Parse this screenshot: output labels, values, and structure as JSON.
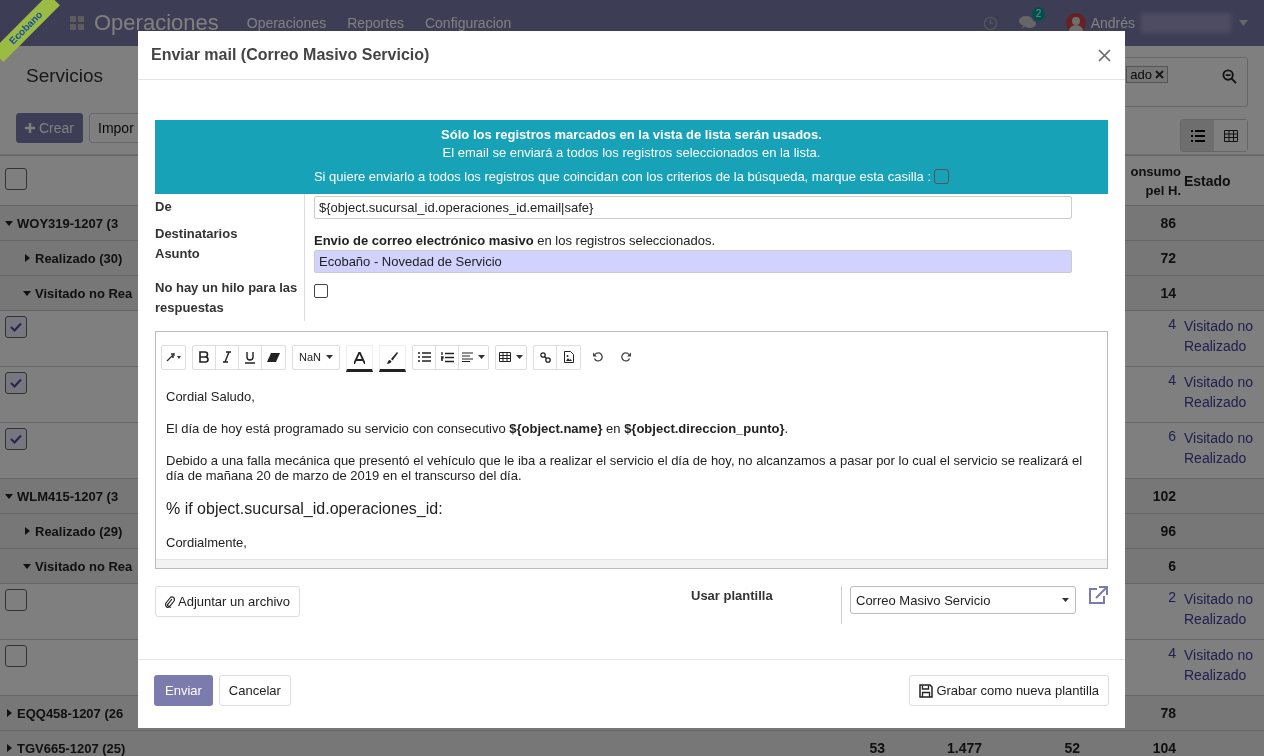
{
  "navbar": {
    "brand": "Operaciones",
    "menu": [
      "Operaciones",
      "Reportes",
      "Configuracion"
    ],
    "messages_count": "2",
    "user_name": "Andrés"
  },
  "ribbon": {
    "label": "Ecobano"
  },
  "breadcrumb": "Servicios",
  "create_button": "Crear",
  "import_button": "Impor",
  "search": {
    "facet": "ado"
  },
  "views": [
    {
      "kind": "list",
      "selected": true
    },
    {
      "kind": "grid",
      "selected": false
    }
  ],
  "table": {
    "select_all": false,
    "columns": [
      "onsumo\npel H.",
      "Estado"
    ],
    "rows": [
      {
        "kind": "group",
        "label": "WOY319-1207 (3",
        "expanded": true,
        "value": "86"
      },
      {
        "kind": "subgroup",
        "label": "Realizado (30)",
        "expanded": false,
        "value": "72"
      },
      {
        "kind": "subgroup",
        "label": "Visitado no Rea",
        "expanded": true,
        "value": "14"
      },
      {
        "kind": "record",
        "checked": true,
        "value": "4",
        "estado": "Visitado no\nRealizado"
      },
      {
        "kind": "record",
        "checked": true,
        "value": "4",
        "estado": "Visitado no\nRealizado"
      },
      {
        "kind": "record",
        "checked": true,
        "value": "6",
        "estado": "Visitado no\nRealizado"
      },
      {
        "kind": "group",
        "label": "WLM415-1207 (3",
        "expanded": true,
        "value": "102"
      },
      {
        "kind": "subgroup",
        "label": "Realizado (29)",
        "expanded": false,
        "value": "96"
      },
      {
        "kind": "subgroup",
        "label": "Visitado no Rea",
        "expanded": true,
        "value": "6"
      },
      {
        "kind": "record",
        "checked": false,
        "value": "2",
        "estado": "Visitado no\nRealizado"
      },
      {
        "kind": "record",
        "checked": false,
        "value": "4",
        "estado": "Visitado no\nRealizado"
      },
      {
        "kind": "group",
        "label": "EQQ458-1207 (26",
        "expanded": false,
        "value": "78"
      },
      {
        "kind": "group",
        "label": "TGV665-1207 (25)",
        "expanded": false,
        "extra": [
          "53",
          "1.477",
          "52"
        ],
        "value": "104"
      }
    ]
  },
  "dialog": {
    "title": "Enviar mail (Correo Masivo Servicio)",
    "alert": {
      "title": "Sólo los registros marcados en la vista de lista serán usados.",
      "text": "El email se enviará a todos los registros seleccionados en la lista.",
      "check_label": "Si quiere enviarlo a todos los registros que coincidan con los criterios de la búsqueda, marque esta casilla :",
      "checked": false
    },
    "from_label": "De",
    "from_value": "${object.sucursal_id.operaciones_id.email|safe}",
    "recipients_label": "Destinatarios",
    "recipients_text": "**Envio de correo electrónico masivo** en los registros seleccionados.",
    "subject_label": "Asunto",
    "subject_value": "Ecobaño - Novedad de Servicio",
    "no_thread_label": "No hay un hilo para las respuestas",
    "no_thread_checked": false,
    "toolbar": {
      "font_size": "NaN"
    },
    "body": [
      {
        "kind": "p",
        "text": "Cordial Saludo,"
      },
      {
        "kind": "p",
        "text": "El día de hoy está programado su servicio con consecutivo **${object.name}** en **${object.direccion_punto}**."
      },
      {
        "kind": "p",
        "text": "Debido a una falla mecánica que presentó el vehículo que le iba a realizar el servicio el día de hoy, no alcanzamos a pasar por lo cual el servicio se realizará el día de mañana 20 de marzo de 2019 en el transcurso del día."
      },
      {
        "kind": "code",
        "text": "% if object.sucursal_id.operaciones_id:"
      },
      {
        "kind": "p",
        "text": "Cordialmente,"
      }
    ],
    "attach_button": "Adjuntar un archivo",
    "template_label": "Usar plantilla",
    "template_value": "Correo Masivo Servicio",
    "send_button": "Enviar",
    "cancel_button": "Cancelar",
    "save_template_button": "Grabar como nueva plantilla"
  }
}
